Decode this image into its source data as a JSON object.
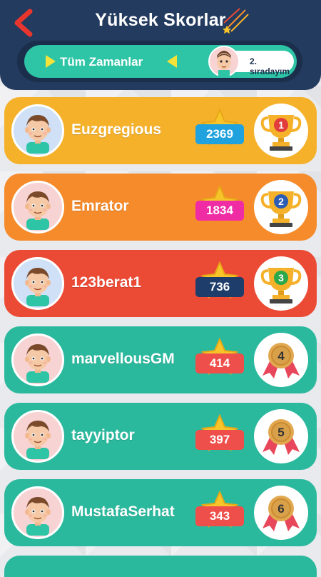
{
  "header": {
    "title": "Yüksek Skorlar",
    "filter_label": "Tüm Zamanlar",
    "my_rank": "2. sıradayım"
  },
  "players": [
    {
      "rank": "1",
      "name": "Euzgregious",
      "score": "2369",
      "row_color": "#f5b12a",
      "score_color": "#1fa2dd",
      "avatar_bg": "#cfe0f7",
      "award": "trophy",
      "award_color": "#e23d3d"
    },
    {
      "rank": "2",
      "name": "Emrator",
      "score": "1834",
      "row_color": "#f58b2b",
      "score_color": "#f02ca4",
      "avatar_bg": "#f8d3d3",
      "award": "trophy",
      "award_color": "#2c5db2"
    },
    {
      "rank": "3",
      "name": "123berat1",
      "score": "736",
      "row_color": "#eb4a35",
      "score_color": "#1f3d6b",
      "avatar_bg": "#cfe0f7",
      "award": "trophy",
      "award_color": "#2aa84a"
    },
    {
      "rank": "4",
      "name": "marvellousGM",
      "score": "414",
      "row_color": "#2bb99e",
      "score_color": "#ef4f4a",
      "avatar_bg": "#f8d3d3",
      "award": "medal",
      "award_color": "#d9a04a"
    },
    {
      "rank": "5",
      "name": "tayyiptor",
      "score": "397",
      "row_color": "#2bb99e",
      "score_color": "#ef4f4a",
      "avatar_bg": "#f8d3d3",
      "award": "medal",
      "award_color": "#d9a04a"
    },
    {
      "rank": "6",
      "name": "MustafaSerhat",
      "score": "343",
      "row_color": "#2bb99e",
      "score_color": "#ef4f4a",
      "avatar_bg": "#f8d3d3",
      "award": "medal",
      "award_color": "#d9a04a"
    }
  ],
  "colors": {
    "header_bg": "#233b5e",
    "filter_bg": "#2ec4a6",
    "accent_red": "#e8362e",
    "star": "#f7c52a"
  }
}
